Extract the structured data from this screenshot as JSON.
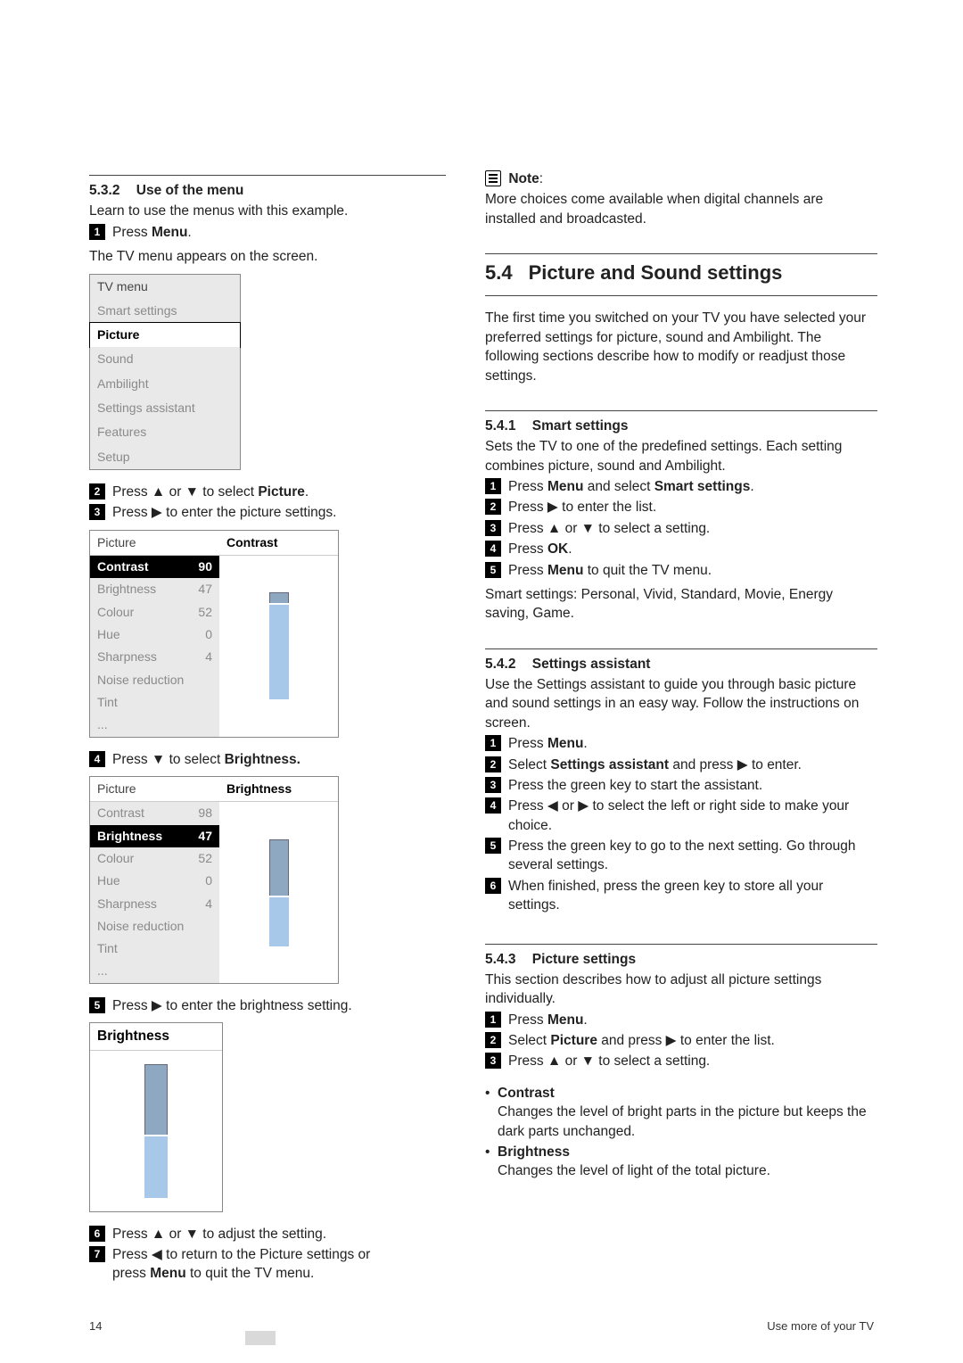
{
  "left": {
    "s532": {
      "num": "5.3.2",
      "title": "Use of the menu",
      "intro": "Learn to use the menus with this example.",
      "step1": "Press Menu.",
      "step1_bold": "Menu",
      "after1": "The TV menu appears on the screen."
    },
    "tvmenu": {
      "header": "TV menu",
      "items": [
        "Smart settings",
        "Picture",
        "Sound",
        "Ambilight",
        "Settings assistant",
        "Features",
        "Setup"
      ],
      "selected": "Picture"
    },
    "step2": "Press ▲ or ▼ to select Picture.",
    "step2_bold": "Picture",
    "step3": "Press ▶ to enter the picture settings.",
    "picmenu1": {
      "header_left": "Picture",
      "header_right": "Contrast",
      "rows": [
        {
          "label": "Contrast",
          "val": "90",
          "sel": true
        },
        {
          "label": "Brightness",
          "val": "47"
        },
        {
          "label": "Colour",
          "val": "52"
        },
        {
          "label": "Hue",
          "val": "0"
        },
        {
          "label": "Sharpness",
          "val": "4"
        },
        {
          "label": "Noise reduction",
          "val": ""
        },
        {
          "label": "Tint",
          "val": ""
        },
        {
          "label": "...",
          "val": ""
        }
      ],
      "fill_pct": 90
    },
    "step4": "Press ▼ to select Brightness.",
    "step4_bold": "Brightness.",
    "picmenu2": {
      "header_left": "Picture",
      "header_right": "Brightness",
      "rows": [
        {
          "label": "Contrast",
          "val": "98"
        },
        {
          "label": "Brightness",
          "val": "47",
          "sel": true
        },
        {
          "label": "Colour",
          "val": "52"
        },
        {
          "label": "Hue",
          "val": "0"
        },
        {
          "label": "Sharpness",
          "val": "4"
        },
        {
          "label": "Noise reduction",
          "val": ""
        },
        {
          "label": "Tint",
          "val": ""
        },
        {
          "label": "...",
          "val": ""
        }
      ],
      "fill_pct": 47
    },
    "step5": "Press ▶ to enter the brightness setting.",
    "bslider": {
      "header": "Brightness",
      "fill_pct": 47
    },
    "step6": "Press ▲ or ▼ to adjust the setting.",
    "step7a": "Press ◀ to return to the Picture settings or",
    "step7b": "press Menu  to quit the TV menu.",
    "step7_bold": "Menu"
  },
  "right": {
    "note_title": "Note",
    "note_body": "More choices come available when digital channels are installed and broadcasted.",
    "s54": {
      "num": "5.4",
      "title": "Picture and Sound settings"
    },
    "s54_intro": "The first time you switched on your TV you have selected your preferred settings for picture, sound and Ambilight. The following sections describe how to modify or readjust those settings.",
    "s541": {
      "num": "5.4.1",
      "title": "Smart settings",
      "intro": "Sets the TV to one of the predefined settings. Each setting combines picture, sound and Ambilight.",
      "steps": [
        "Press Menu and select Smart settings.",
        "Press ▶ to enter the list.",
        "Press ▲ or ▼ to select a setting.",
        "Press OK.",
        "Press Menu to quit the TV menu."
      ],
      "bolds": [
        "Menu",
        "Smart settings",
        "OK"
      ],
      "after": "Smart settings: Personal, Vivid, Standard, Movie, Energy saving, Game."
    },
    "s542": {
      "num": "5.4.2",
      "title": "Settings assistant",
      "intro": "Use the Settings assistant to guide you through basic picture and sound settings in an easy way. Follow the instructions on screen.",
      "steps": [
        "Press Menu.",
        "Select Settings assistant and press ▶ to enter.",
        "Press the green key to start the assistant.",
        "Press ◀ or ▶ to select the left or right side to make your choice.",
        "Press the green key to go to the next setting. Go through several settings.",
        "When finished, press the green key to store all your settings."
      ],
      "bolds": [
        "Menu",
        "Settings assistant"
      ]
    },
    "s543": {
      "num": "5.4.3",
      "title": "Picture settings",
      "intro": "This section describes how to adjust all picture settings individually.",
      "steps": [
        "Press Menu.",
        "Select Picture and press ▶ to enter the list.",
        "Press ▲ or ▼ to select a setting."
      ],
      "bolds": [
        "Menu",
        "Picture"
      ],
      "bullets": [
        {
          "t": "Contrast",
          "d": "Changes the level of bright parts in the picture but keeps the dark parts unchanged."
        },
        {
          "t": "Brightness",
          "d": "Changes the level of light of the total picture."
        }
      ]
    }
  },
  "footer": {
    "page": "14",
    "right": "Use more of your TV"
  }
}
